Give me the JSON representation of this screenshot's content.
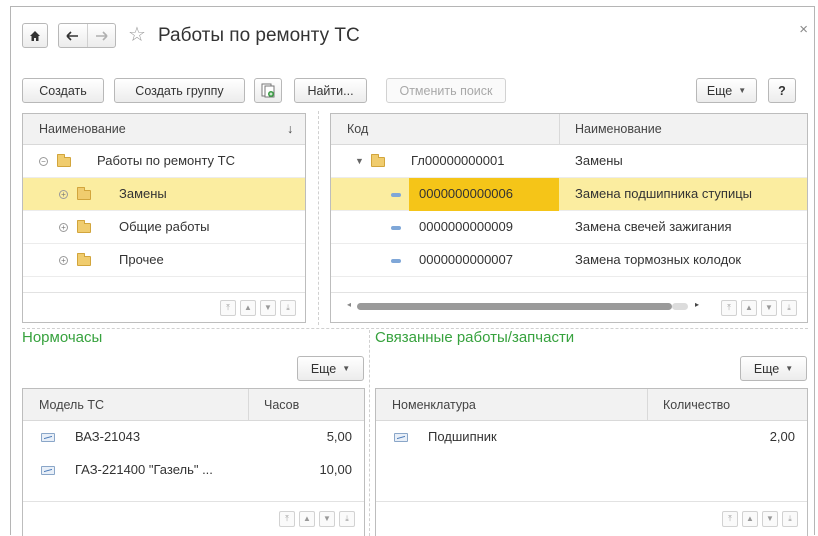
{
  "window": {
    "title": "Работы по ремонту ТС",
    "close_label": "×",
    "home_icon": "home-icon",
    "back_icon": "arrow-left-icon",
    "forward_icon": "arrow-right-icon",
    "star_icon": "star-icon"
  },
  "toolbar": {
    "create": "Создать",
    "create_group": "Создать группу",
    "find": "Найти...",
    "cancel_search": "Отменить поиск",
    "more": "Еще",
    "help": "?"
  },
  "tree": {
    "col_name": "Наименование",
    "sort_arrow": "↓",
    "items": [
      {
        "label": "Работы по ремонту ТС"
      },
      {
        "label": "Замены"
      },
      {
        "label": "Общие работы"
      },
      {
        "label": "Прочее"
      }
    ]
  },
  "list": {
    "col_code": "Код",
    "col_name": "Наименование",
    "rows": [
      {
        "code": "Гл00000000001",
        "name": "Замены"
      },
      {
        "code": "0000000000006",
        "name": "Замена подшипника ступицы"
      },
      {
        "code": "0000000000009",
        "name": "Замена свечей зажигания"
      },
      {
        "code": "0000000000007",
        "name": "Замена тормозных колодок"
      }
    ]
  },
  "normohours": {
    "title": "Нормочасы",
    "more": "Еще",
    "col_model": "Модель ТС",
    "col_hours": "Часов",
    "rows": [
      {
        "model": "ВАЗ-21043",
        "hours": "5,00"
      },
      {
        "model": "ГАЗ-221400 \"Газель\" ...",
        "hours": "10,00"
      }
    ]
  },
  "related": {
    "title": "Связанные работы/запчасти",
    "more": "Еще",
    "col_item": "Номенклатура",
    "col_qty": "Количество",
    "rows": [
      {
        "item": "Подшипник",
        "qty": "2,00"
      }
    ]
  },
  "colors": {
    "accent_green": "#37a23e",
    "selection": "#fbeda0",
    "selection_strong": "#f5c518"
  }
}
